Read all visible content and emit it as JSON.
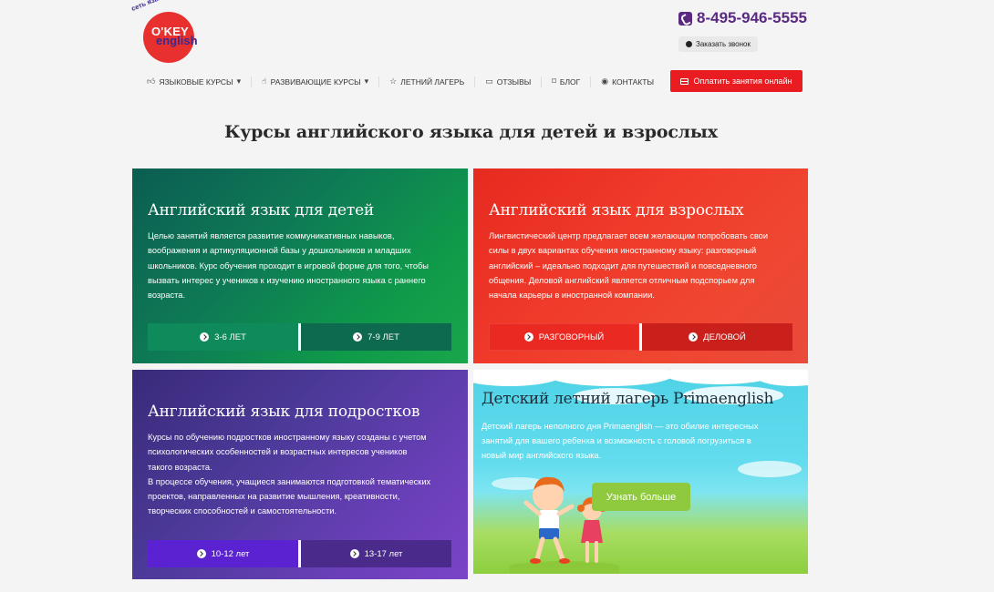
{
  "logo": {
    "arc": "сеть языковых центров",
    "line1": "O'KEY",
    "line2": "english"
  },
  "header": {
    "phone": "8-495-946-5555",
    "callback": "Заказать звонок"
  },
  "nav": {
    "items": [
      {
        "label": "ЯЗЫКОВЫЕ КУРСЫ",
        "icon": "thumbs-up-icon",
        "caret": true
      },
      {
        "label": "РАЗВИВАЮЩИЕ КУРСЫ",
        "icon": "hand-pointer-icon",
        "caret": true
      },
      {
        "label": "ЛЕТНИЙ ЛАГЕРЬ",
        "icon": "star-icon",
        "caret": false
      },
      {
        "label": "ОТЗЫВЫ",
        "icon": "comment-icon",
        "caret": false
      },
      {
        "label": "БЛОГ",
        "icon": "bookmark-icon",
        "caret": false
      },
      {
        "label": "КОНТАКТЫ",
        "icon": "eye-icon",
        "caret": false
      }
    ],
    "pay_label": "Оплатить занятия онлайн"
  },
  "page_title": "Курсы английского языка для детей и взрослых",
  "cards": {
    "kids": {
      "title": "Английский язык для детей",
      "text": [
        "Целью занятий является развитие коммуникативных навыков,",
        "воображения и артикуляционной базы у дошкольников и младших",
        "школьников. Курс обучения проходит в игровой форме для того, чтобы",
        "вызвать интерес у учеников к изучению иностранного языка с раннего",
        "возраста."
      ],
      "btn1": "3-6 ЛЕТ",
      "btn2": "7-9 ЛЕТ"
    },
    "adults": {
      "title": "Английский язык для взрослых",
      "text": [
        "Лингвистический центр предлагает всем желающим попробовать свои",
        "силы в двух вариантах обучения иностранному языку: разговорный",
        "английский – идеально подходит для путешествий и повседневного",
        "общения. Деловой английский является отличным подспорьем для",
        "начала карьеры в иностранной компании."
      ],
      "btn1": "РАЗГОВОРНЫЙ",
      "btn2": "ДЕЛОВОЙ"
    },
    "teens": {
      "title": "Английский язык для подростков",
      "text": [
        "Курсы по обучению подростков иностранному языку созданы с учетом",
        "психологических особенностей и возрастных интересов учеников",
        "такого возраста.",
        "В процессе обучения, учащиеся занимаются подготовкой тематических",
        "проектов, направленных на развитие мышления, креативности,",
        "творческих способностей и самостоятельности."
      ],
      "btn1": "10-12 лет",
      "btn2": "13-17 лет"
    },
    "camp": {
      "title": "Детский летний лагерь Primaenglish",
      "text": [
        "Детский лагерь неполного дня Primaenglish — это обилие интересных",
        "занятий для вашего ребенка и возможность с головой погрузиться в",
        "новый мир английского языка."
      ],
      "btn": "Узнать больше"
    }
  },
  "colors": {
    "brand_purple": "#5a2a82",
    "pay_red": "#e91c22",
    "kids_btn1": "#0f8a5a",
    "kids_btn2": "#0d6a4e",
    "adults_btn1": "#ea2a22",
    "adults_btn2": "#c9201c",
    "teens_btn1": "#5a22d0",
    "teens_btn2": "#4a2a8a",
    "camp_btn": "#8fca3e"
  }
}
